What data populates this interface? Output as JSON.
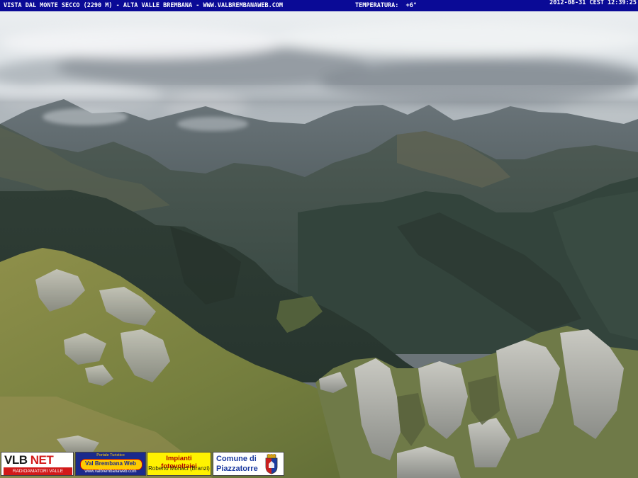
{
  "overlay": {
    "caption": "VISTA DAL MONTE SECCO (2290 M) - ALTA VALLE BREMBANA - WWW.VALBREMBANAWEB.COM",
    "temperature_label": "TEMPERATURA:",
    "temperature_value": "+6°",
    "timestamp": "2012-08-31 CEST 12:39:25"
  },
  "logos": {
    "vlb_brand_a": "VLB",
    "vlb_brand_b": "NET",
    "vlb_sub": "RADIOAMATORI VALLE BREMBANA",
    "vbw_top": "Portale Turistico",
    "vbw_mid": "Val Brembana Web",
    "vbw_url": "www.valbrembanaweb.com",
    "solar_line1": "Impianti fotovoltaici",
    "solar_line2": "Roberto Monaci (Branzi)",
    "comune_line1": "Comune di",
    "comune_line2": "Piazzatorre"
  },
  "colors": {
    "overlay_bar": "#0a0a96",
    "overlay_text": "#ffffff",
    "vlb_red": "#d21a1a",
    "solar_yellow": "#fff200",
    "comune_blue": "#1b3aa0"
  }
}
